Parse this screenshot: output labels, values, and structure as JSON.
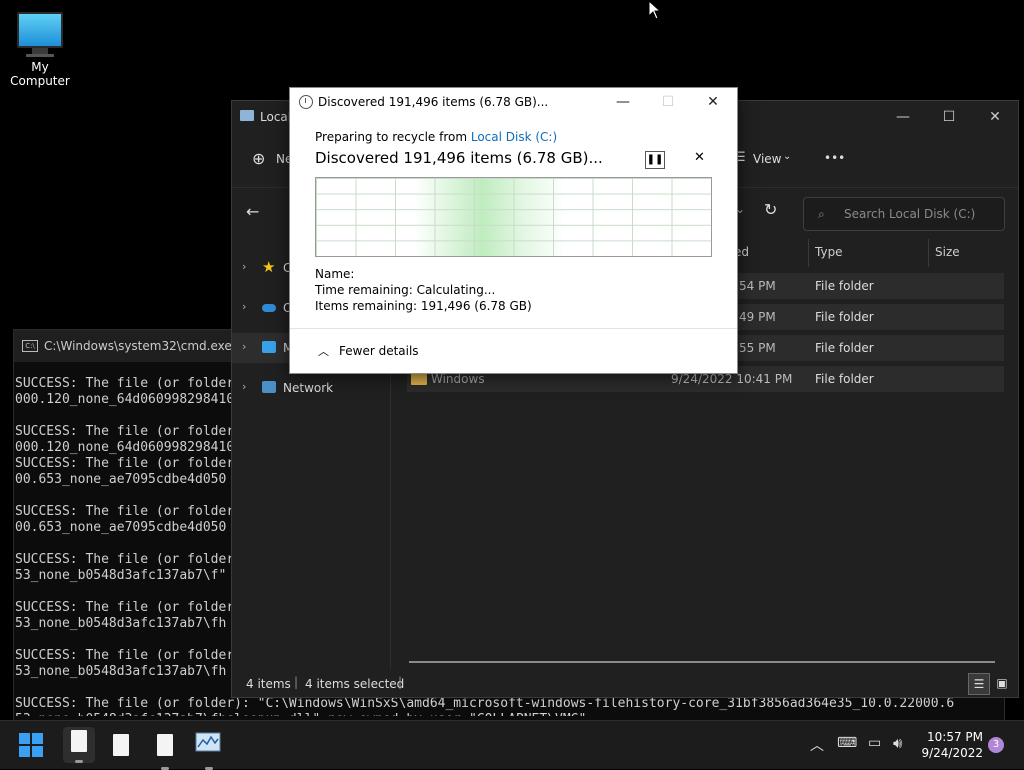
{
  "desktop": {
    "my_computer": "My Computer"
  },
  "cmd": {
    "title": "C:\\Windows\\system32\\cmd.exe",
    "lines": "SUCCESS: The file (or folder\n000.120_none_64d060998298410\n\nSUCCESS: The file (or folder\n000.120_none_64d060998298410\nSUCCESS: The file (or folder\n00.653_none_ae7095cdbe4d050\n\nSUCCESS: The file (or folder\n00.653_none_ae7095cdbe4d050\n\nSUCCESS: The file (or folder\n53_none_b0548d3afc137ab7\\f\"\n\nSUCCESS: The file (or folder\n53_none_b0548d3afc137ab7\\fh\n\nSUCCESS: The file (or folder\n53_none_b0548d3afc137ab7\\fh\n\nSUCCESS: The file (or folder): \"C:\\Windows\\WinSxS\\amd64_microsoft-windows-filehistory-core_31bf3856ad364e35_10.0.22000.6\n53_none_b0548d3afc137ab7\\fhsleepup.dll\" now owned by user \"COLLAPNET\\VMG\""
  },
  "explorer": {
    "title": "Local",
    "new_label": "Ne",
    "view_label": "View",
    "more_label": "•••",
    "search_placeholder": "Search Local Disk (C:)",
    "columns": {
      "date": "ed",
      "type": "Type",
      "size": "Size"
    },
    "nav": [
      {
        "label": "C"
      },
      {
        "label": "O"
      },
      {
        "label": "M"
      },
      {
        "label": "Network"
      }
    ],
    "rows": [
      {
        "name": "",
        "date": ":54 PM",
        "type": "File folder"
      },
      {
        "name": "",
        "date": ":49 PM",
        "type": "File folder"
      },
      {
        "name": "",
        "date": ":55 PM",
        "type": "File folder"
      },
      {
        "name": "Windows",
        "date": "9/24/2022 10:41 PM",
        "type": "File folder"
      }
    ],
    "status_items": "4 items",
    "status_selected": "4 items selected"
  },
  "dialog": {
    "title": "Discovered 191,496 items (6.78 GB)...",
    "preparing_prefix": "Preparing to recycle from ",
    "preparing_link": "Local Disk (C:)",
    "heading": "Discovered 191,496 items (6.78 GB)...",
    "name_label": "Name:",
    "time_remaining": "Time remaining:  Calculating...",
    "items_remaining": "Items remaining:  191,496 (6.78 GB)",
    "fewer_details": "Fewer details"
  },
  "taskbar": {
    "time": "10:57 PM",
    "date": "9/24/2022",
    "notifications": "3"
  },
  "colors": {
    "accent": "#0f6cbd",
    "start": "#3aa0f3",
    "folder": "#e0b44a"
  }
}
